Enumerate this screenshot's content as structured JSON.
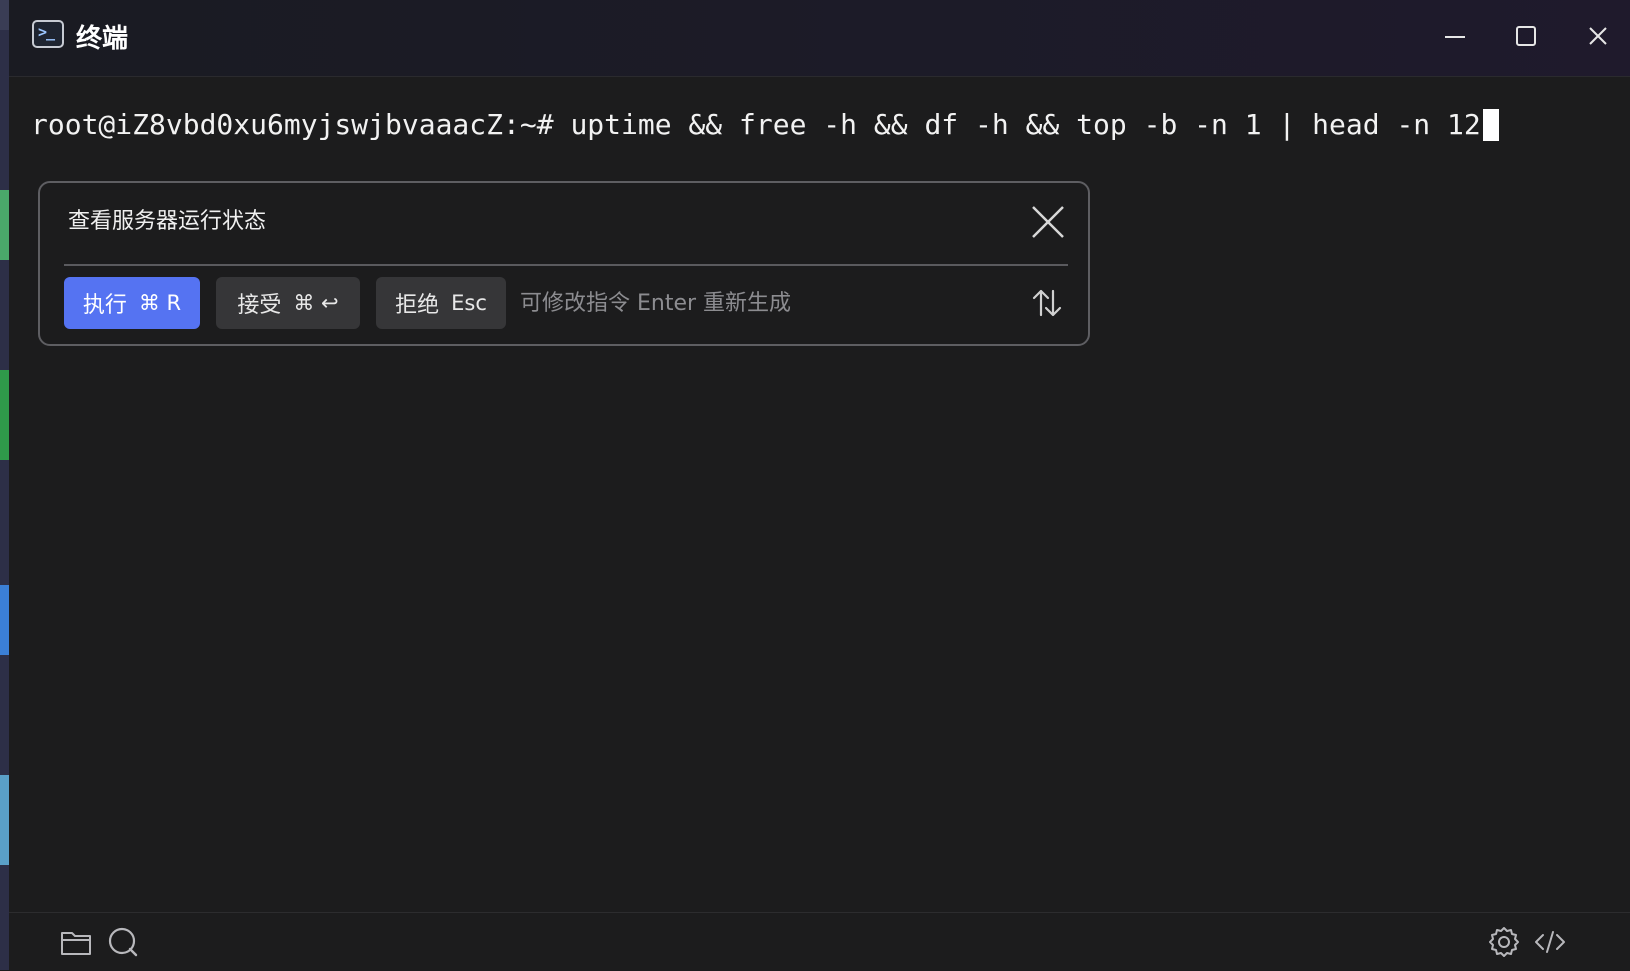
{
  "window": {
    "title": "终端",
    "app_icon": "terminal-icon",
    "controls": [
      "minimize-icon",
      "maximize-icon",
      "close-icon"
    ]
  },
  "terminal": {
    "command_line": "root@iZ8vbd0xu6myjswjbvaaacZ:~# uptime && free -h && df -h && top -b -n 1 | head -n 12"
  },
  "ai_panel": {
    "query": "查看服务器运行状态",
    "run_button": {
      "label": "执行",
      "shortcut": "⌘ R"
    },
    "accept_button": {
      "label": "接受",
      "shortcut": "⌘ ↩"
    },
    "reject_button": {
      "label": "拒绝",
      "shortcut": "Esc"
    },
    "input_placeholder": "可修改指令 Enter 重新生成",
    "accent_color": "#5573f2"
  },
  "statusbar": {
    "left_icons": [
      "folder-icon",
      "chat-search-icon"
    ],
    "right_icons": [
      "settings-gear-icon",
      "code-icon"
    ]
  }
}
